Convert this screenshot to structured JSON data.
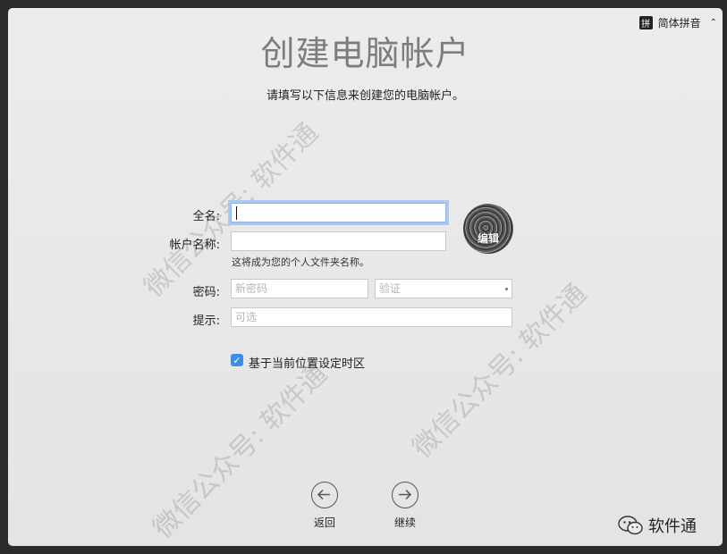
{
  "ime": {
    "badge": "拼",
    "label": "简体拼音",
    "arrows": "⌃⌄"
  },
  "title": "创建电脑帐户",
  "subtitle": "请填写以下信息来创建您的电脑帐户。",
  "form": {
    "fullname_label": "全名:",
    "fullname_value": "",
    "account_label": "帐户名称:",
    "account_value": "",
    "account_hint": "这将成为您的个人文件夹名称。",
    "password_label": "密码:",
    "password_placeholder": "新密码",
    "verify_placeholder": "验证",
    "hint_label": "提示:",
    "hint_placeholder": "可选"
  },
  "avatar": {
    "edit_label": "编辑"
  },
  "timezone_checkbox": {
    "checked": true,
    "label": "基于当前位置设定时区"
  },
  "nav": {
    "back_label": "返回",
    "continue_label": "继续"
  },
  "watermark": {
    "text": "微信公众号: 软件通"
  },
  "wechat_badge": {
    "text": "软件通"
  }
}
